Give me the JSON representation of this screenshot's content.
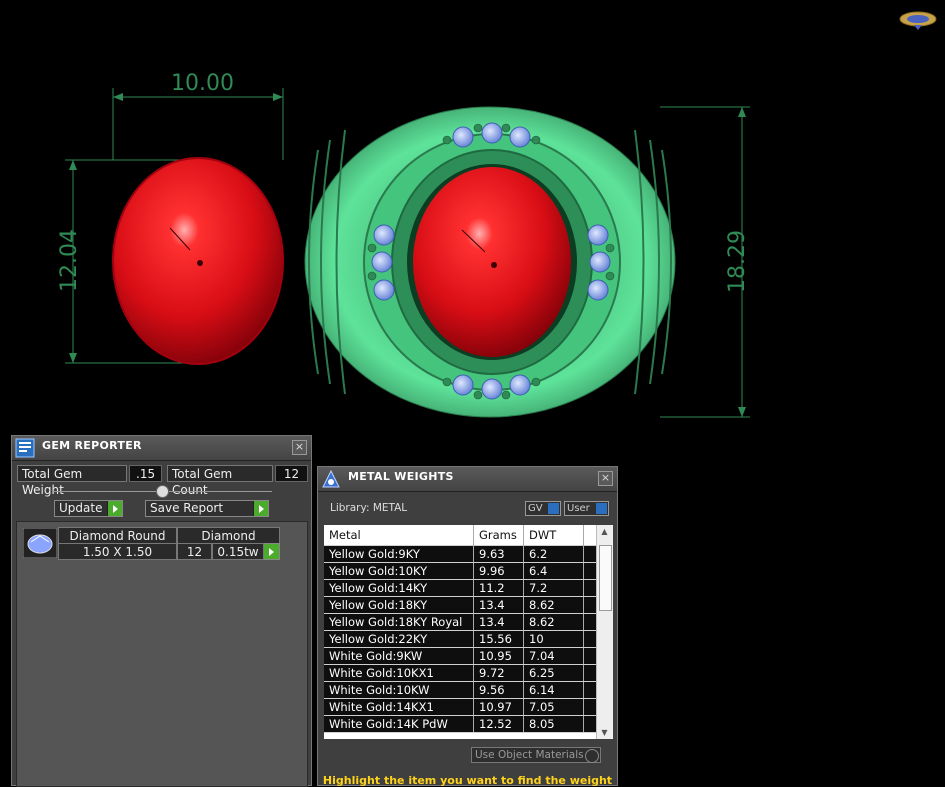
{
  "viewport": {
    "dim_width_gem": "10.00",
    "dim_height_gem": "12.04",
    "dim_height_ring": "18.29"
  },
  "gem_reporter": {
    "title": "GEM REPORTER",
    "total_weight_label": "Total Gem Weight",
    "total_weight_value": ".15",
    "total_count_label": "Total Gem Count",
    "total_count_value": "12",
    "update_label": "Update",
    "save_report_label": "Save Report",
    "row": {
      "shape": "Diamond Round",
      "material": "Diamond",
      "size": "1.50 X 1.50",
      "count": "12",
      "weight": "0.15tw"
    }
  },
  "metal_weights": {
    "title": "METAL WEIGHTS",
    "library_label": "Library: METAL",
    "gv_label": "GV",
    "user_label": "User",
    "columns": [
      "Metal",
      "Grams",
      "DWT"
    ],
    "rows": [
      {
        "metal": "Yellow Gold:9KY",
        "grams": "9.63",
        "dwt": "6.2"
      },
      {
        "metal": "Yellow Gold:10KY",
        "grams": "9.96",
        "dwt": "6.4"
      },
      {
        "metal": "Yellow Gold:14KY",
        "grams": "11.2",
        "dwt": "7.2"
      },
      {
        "metal": "Yellow Gold:18KY",
        "grams": "13.4",
        "dwt": "8.62"
      },
      {
        "metal": "Yellow Gold:18KY Royal",
        "grams": "13.4",
        "dwt": "8.62"
      },
      {
        "metal": "Yellow Gold:22KY",
        "grams": "15.56",
        "dwt": "10"
      },
      {
        "metal": "White Gold:9KW",
        "grams": "10.95",
        "dwt": "7.04"
      },
      {
        "metal": "White Gold:10KX1",
        "grams": "9.72",
        "dwt": "6.25"
      },
      {
        "metal": "White Gold:10KW",
        "grams": "9.56",
        "dwt": "6.14"
      },
      {
        "metal": "White Gold:14KX1",
        "grams": "10.97",
        "dwt": "7.05"
      },
      {
        "metal": "White Gold:14K PdW",
        "grams": "12.52",
        "dwt": "8.05"
      }
    ],
    "use_object_materials_label": "Use Object Materials",
    "hint": "Highlight the item you want to find the weight"
  },
  "colors": {
    "ring_green": "#4fd889",
    "gem_red": "#e0101a",
    "dimension_green": "#2f8a55",
    "hint_yellow": "#ffd21c"
  }
}
